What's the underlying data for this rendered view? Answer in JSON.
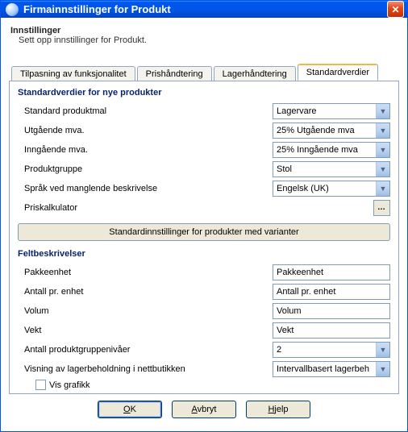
{
  "window": {
    "title": "Firmainnstillinger for Produkt"
  },
  "header": {
    "title": "Innstillinger",
    "subtitle": "Sett opp innstillinger for Produkt."
  },
  "tabs": [
    {
      "label": "Tilpasning av funksjonalitet",
      "active": false
    },
    {
      "label": "Prishåndtering",
      "active": false
    },
    {
      "label": "Lagerhåndtering",
      "active": false
    },
    {
      "label": "Standardverdier",
      "active": true
    }
  ],
  "section1": {
    "title": "Standardverdier for nye produkter",
    "rows": {
      "template": {
        "label": "Standard produktmal",
        "value": "Lagervare"
      },
      "out_vat": {
        "label": "Utgående mva.",
        "value": "25%  Utgående mva"
      },
      "in_vat": {
        "label": "Inngående mva.",
        "value": "25% Inngående mva"
      },
      "group": {
        "label": "Produktgruppe",
        "value": "Stol"
      },
      "lang": {
        "label": "Språk ved manglende beskrivelse",
        "value": "Engelsk (UK)"
      },
      "pricecalc": {
        "label": "Priskalkulator"
      }
    },
    "variant_button": "Standardinnstillinger for produkter med varianter"
  },
  "section2": {
    "title": "Feltbeskrivelser",
    "rows": {
      "pack_unit": {
        "label": "Pakkeenhet",
        "value": "Pakkeenhet"
      },
      "per_unit": {
        "label": "Antall pr. enhet",
        "value": "Antall pr. enhet"
      },
      "volume": {
        "label": "Volum",
        "value": "Volum"
      },
      "weight": {
        "label": "Vekt",
        "value": "Vekt"
      },
      "levels": {
        "label": "Antall produktgruppenivåer",
        "value": "2"
      },
      "stockview": {
        "label": "Visning av lagerbeholdning i nettbutikken",
        "value": "Intervallbasert lagerbeholdnin"
      }
    },
    "show_graphics": {
      "label": "Vis grafikk",
      "checked": false
    }
  },
  "footer": {
    "ok": "OK",
    "cancel": "Avbryt",
    "help": "Hjelp"
  }
}
